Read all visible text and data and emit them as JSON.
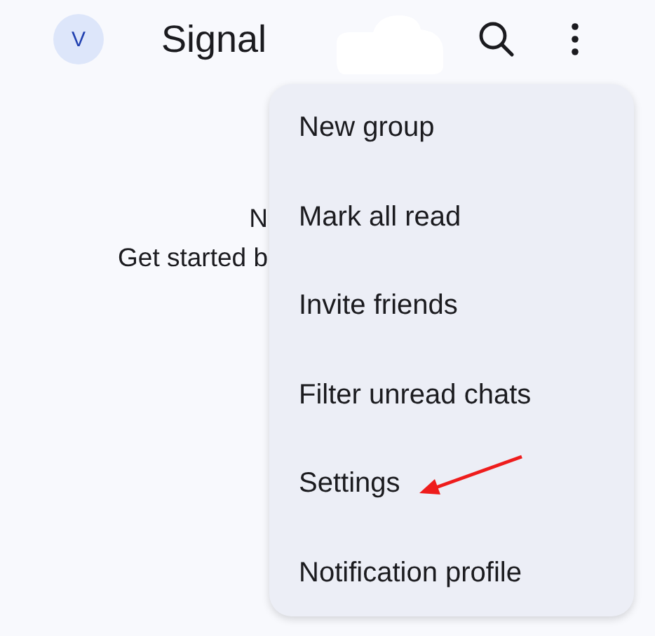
{
  "app_bar": {
    "avatar_initial": "V",
    "title": "Signal"
  },
  "empty_state": {
    "heading": "N",
    "subtitle": "Get started b"
  },
  "menu": {
    "items": [
      {
        "label": "New group"
      },
      {
        "label": "Mark all read"
      },
      {
        "label": "Invite friends"
      },
      {
        "label": "Filter unread chats"
      },
      {
        "label": "Settings",
        "annotated": true
      },
      {
        "label": "Notification profile"
      }
    ]
  }
}
